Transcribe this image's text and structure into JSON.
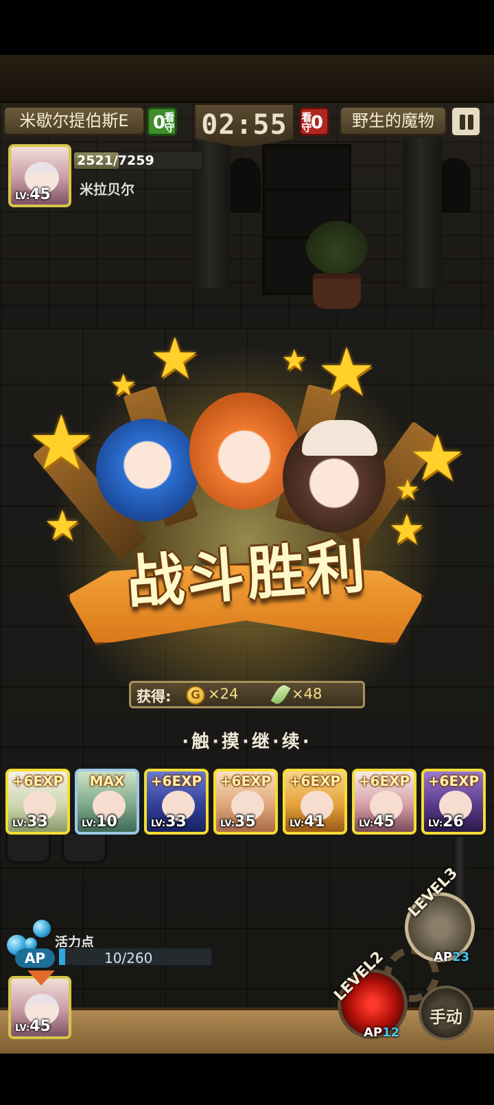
{
  "hud": {
    "left_team_name": "米歇尔提伯斯E",
    "left_score": "0",
    "left_guard_label": "看守",
    "timer": "02:55",
    "right_guard_label": "看守",
    "right_score": "0",
    "right_team_name": "野生的魔物",
    "pause_icon": "pause-icon"
  },
  "leader": {
    "hp_text": "2521/7259",
    "hp_fraction": 0.347,
    "name": "米拉贝尔",
    "level_prefix": "LV:",
    "level": "45"
  },
  "result": {
    "title": "战斗胜利",
    "rewards_label": "获得:",
    "coin_icon_letter": "G",
    "coin_amount": "×24",
    "feather_amount": "×48",
    "continue_text": "·触·摸·继·续·"
  },
  "team": [
    {
      "exp": "+6EXP",
      "level": "33",
      "colors": [
        "#f4efe6",
        "#cfd8b0",
        "#8a9a6a"
      ]
    },
    {
      "exp": "MAX",
      "level": "10",
      "colors": [
        "#cfe3c5",
        "#7fa88a",
        "#3f6a56"
      ]
    },
    {
      "exp": "+6EXP",
      "level": "33",
      "colors": [
        "#6a7ad0",
        "#32409a",
        "#1a2260"
      ]
    },
    {
      "exp": "+6EXP",
      "level": "35",
      "colors": [
        "#f8dfc0",
        "#e0a87a",
        "#a86a4a"
      ]
    },
    {
      "exp": "+6EXP",
      "level": "41",
      "colors": [
        "#f5d48a",
        "#e6a23a",
        "#9a5a1a"
      ]
    },
    {
      "exp": "+6EXP",
      "level": "45",
      "colors": [
        "#f6ece8",
        "#d8a0a8",
        "#7a4a5a"
      ]
    },
    {
      "exp": "+6EXP",
      "level": "26",
      "colors": [
        "#9a7ad0",
        "#5a3a8a",
        "#2a1a4a"
      ]
    }
  ],
  "ap": {
    "label": "活力点",
    "tag": "AP",
    "value_text": "10/260",
    "fraction": 0.04
  },
  "skills": [
    {
      "level_label": "LEVEL",
      "level": "3",
      "ap_prefix": "AP",
      "ap": "23"
    },
    {
      "level_label": "LEVEL",
      "level": "2",
      "ap_prefix": "AP",
      "ap": "12"
    }
  ],
  "manual_label": "手动",
  "bottom_leader": {
    "level_prefix": "LV:",
    "level": "45"
  }
}
